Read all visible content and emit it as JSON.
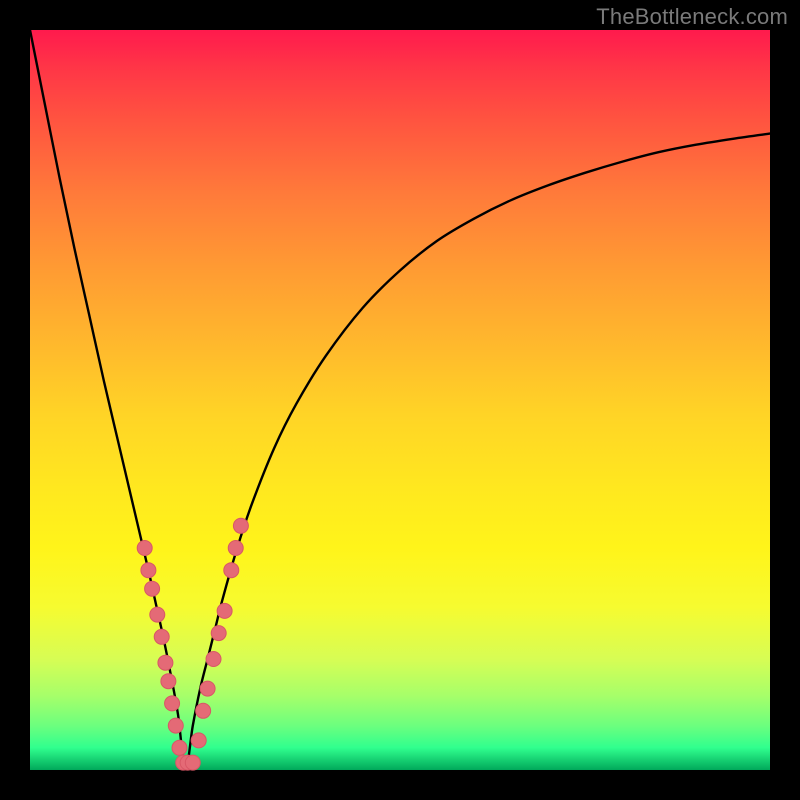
{
  "watermark": "TheBottleneck.com",
  "colors": {
    "curve_stroke": "#000000",
    "marker_fill": "#e46a76",
    "marker_stroke": "#d85766"
  },
  "chart_data": {
    "type": "line",
    "title": "",
    "xlabel": "",
    "ylabel": "",
    "xlim": [
      0,
      100
    ],
    "ylim": [
      0,
      100
    ],
    "ideal_x": 21,
    "series": [
      {
        "name": "bottleneck-curve",
        "x": [
          0,
          2,
          4,
          6,
          8,
          10,
          12,
          14,
          16,
          17,
          18,
          19,
          20,
          21,
          22,
          23,
          24,
          25,
          26,
          28,
          30,
          33,
          36,
          40,
          45,
          50,
          55,
          60,
          65,
          70,
          75,
          80,
          85,
          90,
          95,
          100
        ],
        "y": [
          100,
          90,
          80,
          70.5,
          61.5,
          52.5,
          44,
          35.5,
          27,
          22.5,
          18,
          13,
          7.5,
          0,
          6,
          11,
          15,
          19,
          23,
          30,
          36,
          43.5,
          49.5,
          56,
          62.5,
          67.5,
          71.5,
          74.5,
          77,
          79,
          80.7,
          82.2,
          83.5,
          84.5,
          85.3,
          86
        ]
      }
    ],
    "markers": {
      "name": "sample-points",
      "points": [
        {
          "x": 15.5,
          "y": 30
        },
        {
          "x": 16.0,
          "y": 27
        },
        {
          "x": 16.5,
          "y": 24.5
        },
        {
          "x": 17.2,
          "y": 21
        },
        {
          "x": 17.8,
          "y": 18
        },
        {
          "x": 18.3,
          "y": 14.5
        },
        {
          "x": 18.7,
          "y": 12
        },
        {
          "x": 19.2,
          "y": 9
        },
        {
          "x": 19.7,
          "y": 6
        },
        {
          "x": 20.2,
          "y": 3
        },
        {
          "x": 20.7,
          "y": 1
        },
        {
          "x": 21.3,
          "y": 1
        },
        {
          "x": 22.0,
          "y": 1
        },
        {
          "x": 22.8,
          "y": 4
        },
        {
          "x": 23.4,
          "y": 8
        },
        {
          "x": 24.0,
          "y": 11
        },
        {
          "x": 24.8,
          "y": 15
        },
        {
          "x": 25.5,
          "y": 18.5
        },
        {
          "x": 26.3,
          "y": 21.5
        },
        {
          "x": 27.2,
          "y": 27
        },
        {
          "x": 27.8,
          "y": 30
        },
        {
          "x": 28.5,
          "y": 33
        }
      ]
    }
  }
}
